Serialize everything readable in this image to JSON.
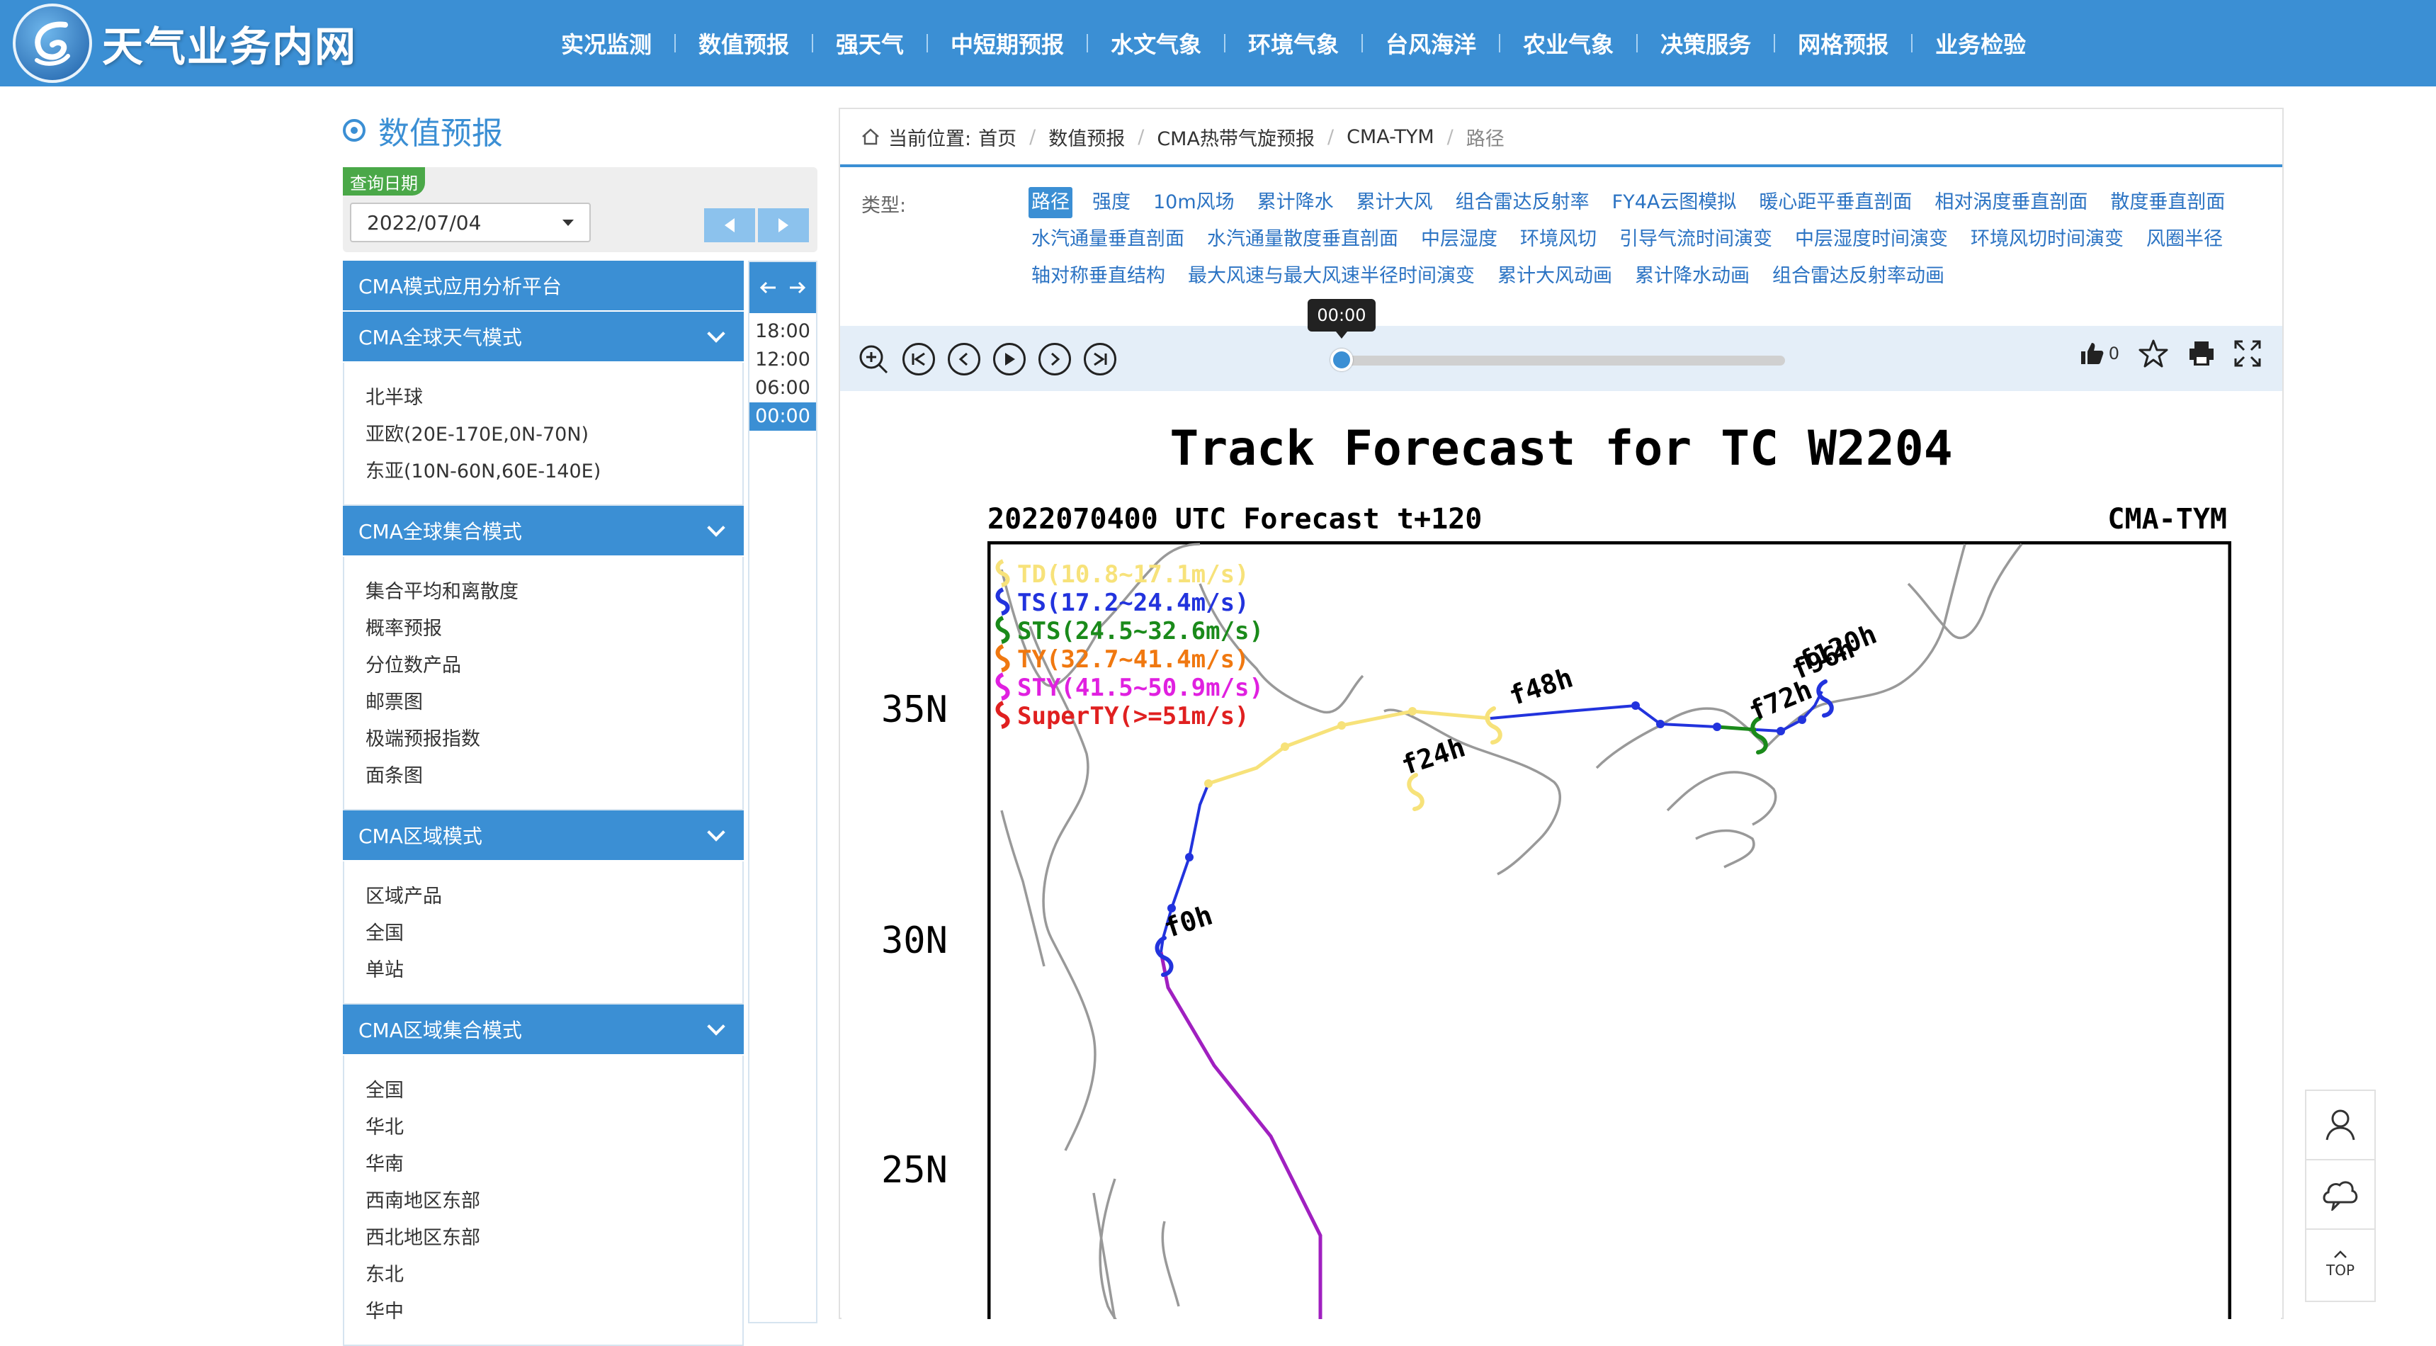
{
  "header": {
    "site_title": "天气业务内网",
    "nav": [
      "实况监测",
      "数值预报",
      "强天气",
      "中短期预报",
      "水文气象",
      "环境气象",
      "台风海洋",
      "农业气象",
      "决策服务",
      "网格预报",
      "业务检验"
    ]
  },
  "sidebar": {
    "title": "数值预报",
    "date_label": "查询日期",
    "date_value": "2022/07/04",
    "platform": "CMA模式应用分析平台",
    "sections": [
      {
        "title": "CMA全球天气模式",
        "items": [
          "北半球",
          "亚欧(20E-170E,0N-70N)",
          "东亚(10N-60N,60E-140E)"
        ]
      },
      {
        "title": "CMA全球集合模式",
        "items": [
          "集合平均和离散度",
          "概率预报",
          "分位数产品",
          "邮票图",
          "极端预报指数",
          "面条图"
        ]
      },
      {
        "title": "CMA区域模式",
        "items": [
          "区域产品",
          "全国",
          "单站"
        ]
      },
      {
        "title": "CMA区域集合模式",
        "items": [
          "全国",
          "华北",
          "华南",
          "西南地区东部",
          "西北地区东部",
          "东北",
          "华中"
        ]
      }
    ],
    "times": [
      "18:00",
      "12:00",
      "06:00",
      "00:00"
    ],
    "active_time": "00:00"
  },
  "breadcrumb": {
    "label": "当前位置:",
    "items": [
      "首页",
      "数值预报",
      "CMA热带气旋预报",
      "CMA-TYM",
      "路径"
    ]
  },
  "types": {
    "label": "类型:",
    "items": [
      "路径",
      "强度",
      "10m风场",
      "累计降水",
      "累计大风",
      "组合雷达反射率",
      "FY4A云图模拟",
      "暖心距平垂直剖面",
      "相对涡度垂直剖面",
      "散度垂直剖面",
      "水汽通量垂直剖面",
      "水汽通量散度垂直剖面",
      "中层湿度",
      "环境风切",
      "引导气流时间演变",
      "中层湿度时间演变",
      "环境风切时间演变",
      "风圈半径",
      "轴对称垂直结构",
      "最大风速与最大风速半径时间演变",
      "累计大风动画",
      "累计降水动画",
      "组合雷达反射率动画"
    ],
    "active": "路径"
  },
  "player": {
    "time_tip": "00:00",
    "like_count": "0"
  },
  "figure": {
    "title": "Track Forecast for TC W2204",
    "subtitle_left": "2022070400 UTC Forecast t+120",
    "subtitle_right": "CMA-TYM",
    "lat_labels": [
      "35N",
      "30N",
      "25N"
    ],
    "legend": [
      {
        "text": "TD(10.8~17.1m/s)",
        "color": "#f7e27a"
      },
      {
        "text": "TS(17.2~24.4m/s)",
        "color": "#2233dd"
      },
      {
        "text": "STS(24.5~32.6m/s)",
        "color": "#1a8a1a"
      },
      {
        "text": "TY(32.7~41.4m/s)",
        "color": "#f07810"
      },
      {
        "text": "STY(41.5~50.9m/s)",
        "color": "#e020e0"
      },
      {
        "text": "SuperTY(>=51m/s)",
        "color": "#e02020"
      }
    ],
    "track_labels": [
      "f0h",
      "f24h",
      "f48h",
      "f72h",
      "f96h",
      "f120h"
    ]
  },
  "float_tools": {
    "top": "TOP"
  },
  "colors": {
    "primary": "#3b8fd4",
    "green_tag": "#4aa848",
    "link": "#2b73c3"
  }
}
